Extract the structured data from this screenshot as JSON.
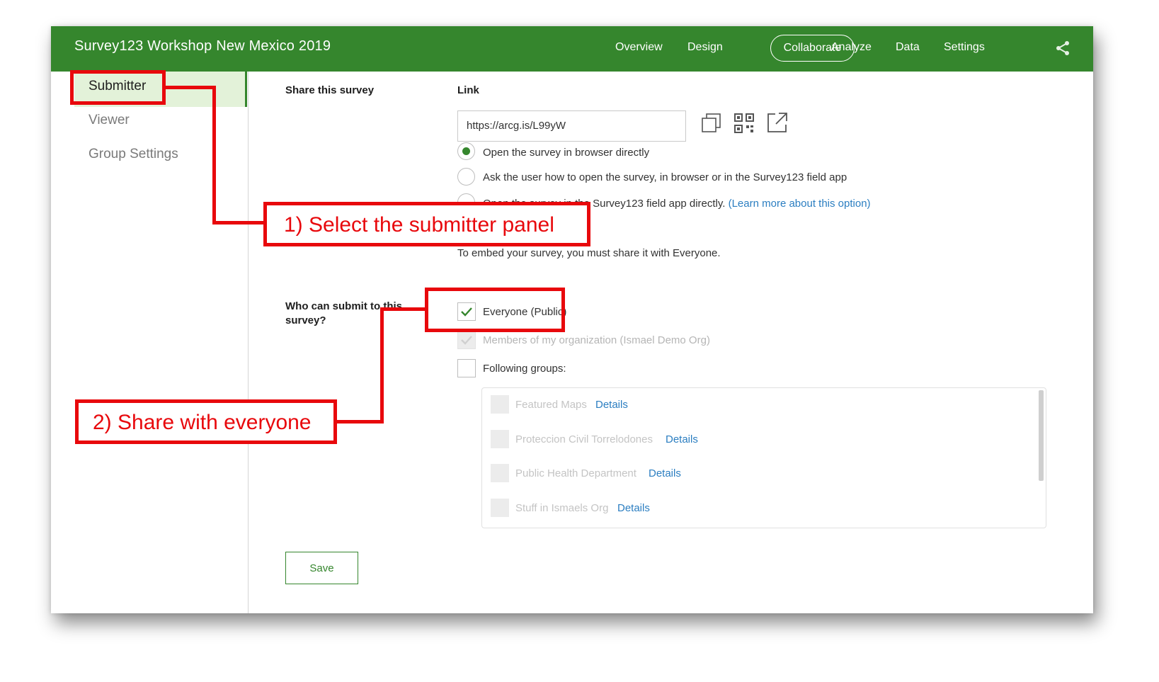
{
  "app": {
    "title": "Survey123 Workshop New Mexico 2019"
  },
  "nav": {
    "overview": "Overview",
    "design": "Design",
    "collaborate": "Collaborate",
    "analyze": "Analyze",
    "data": "Data",
    "settings": "Settings",
    "share_icon": "share-icon"
  },
  "sidebar": {
    "items": [
      {
        "label": "Submitter",
        "active": true
      },
      {
        "label": "Viewer"
      },
      {
        "label": "Group Settings"
      }
    ]
  },
  "share": {
    "section_label": "Share this survey",
    "link_label": "Link",
    "link_value": "https://arcg.is/L99yW",
    "icons": [
      "copy-icon",
      "qr-code-icon",
      "open-external-icon"
    ],
    "options": [
      {
        "label": "Open the survey in browser directly",
        "selected": true
      },
      {
        "label": "Ask the user how to open the survey, in browser or in the Survey123 field app",
        "selected": false
      },
      {
        "label": "Open the survey in the Survey123 field app directly.",
        "link": "(Learn more about this option)",
        "selected": false
      }
    ],
    "embed_note": "To embed your survey, you must share it with Everyone."
  },
  "submit": {
    "label": "Who can submit to this survey?",
    "everyone": {
      "label": "Everyone (Public)",
      "checked": true
    },
    "members": {
      "label": "Members of my organization (Ismael Demo Org)",
      "checked": true,
      "disabled": true
    },
    "following": {
      "label": "Following groups:",
      "checked": false
    },
    "groups": [
      {
        "name": "Featured Maps",
        "details": "Details"
      },
      {
        "name": "Proteccion Civil Torrelodones",
        "details": "Details"
      },
      {
        "name": "Public Health Department",
        "details": "Details"
      },
      {
        "name": "Stuff in Ismaels Org",
        "details": "Details"
      }
    ]
  },
  "save_label": "Save",
  "annotations": {
    "step1": "1) Select the submitter panel",
    "step2": "2) Share with everyone",
    "color": "#e8080c"
  },
  "colors": {
    "brand_green": "#35862d",
    "active_bg": "#e3f2d9",
    "link_blue": "#2b7ec1"
  }
}
